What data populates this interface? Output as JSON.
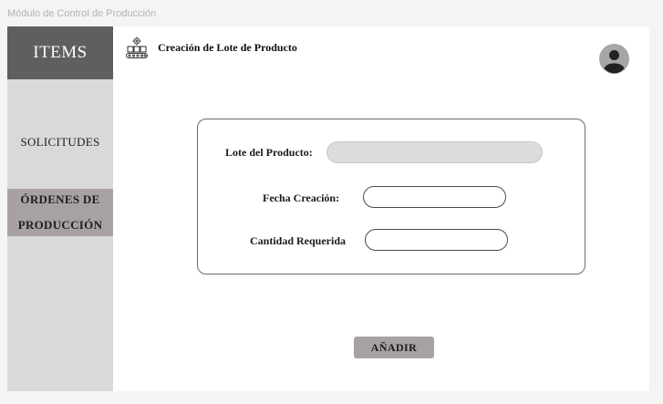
{
  "app": {
    "title": "Módulo de Control de Producción"
  },
  "sidebar": {
    "brand": "ITEMS",
    "items": [
      {
        "label": "SOLICITUDES",
        "active": false
      },
      {
        "label": "ÓRDENES DE PRODUCCIÓN",
        "line1": "ÓRDENES DE",
        "line2": "PRODUCCIÓN",
        "active": true
      }
    ]
  },
  "header": {
    "title": "Creación de Lote de Producto",
    "icon": "production-line-icon",
    "avatar_icon": "user-avatar-icon"
  },
  "form": {
    "lote": {
      "label": "Lote del Producto:",
      "value": "",
      "disabled": true
    },
    "fecha": {
      "label": "Fecha Creación:",
      "value": ""
    },
    "cantidad": {
      "label": "Cantidad Requerida",
      "value": ""
    },
    "submit_label": "AÑADIR"
  },
  "colors": {
    "sidebar_bg": "#d9d9d9",
    "brand_bg": "#5f5f5f",
    "active_item_bg": "#a8a1a1",
    "button_bg": "#a8a1a1",
    "disabled_input_bg": "#dcdcdc"
  }
}
